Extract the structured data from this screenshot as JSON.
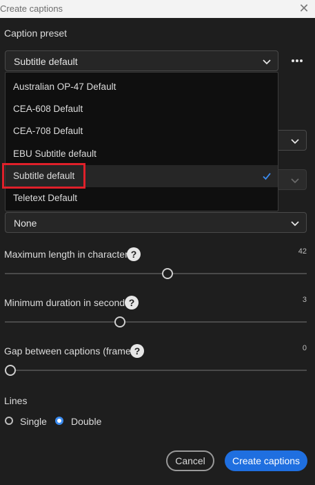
{
  "window": {
    "title": "Create captions",
    "close_icon": "close-icon"
  },
  "caption_preset": {
    "label": "Caption preset",
    "selected": "Subtitle default",
    "options": [
      "Australian OP-47 Default",
      "CEA-608 Default",
      "CEA-708 Default",
      "EBU Subtitle default",
      "Subtitle default",
      "Teletext Default"
    ],
    "selected_index": 4
  },
  "format_select": {
    "value": "None"
  },
  "max_length": {
    "label": "Maximum length in characters",
    "value": "42",
    "level": 0.55
  },
  "min_duration": {
    "label": "Minimum duration in seconds",
    "value": "3",
    "level": 0.38
  },
  "gap_frames": {
    "label": "Gap between captions (frames)",
    "value": "0",
    "level": 0.0
  },
  "lines": {
    "label": "Lines",
    "options": [
      {
        "label": "Single",
        "selected": false
      },
      {
        "label": "Double",
        "selected": true
      }
    ]
  },
  "buttons": {
    "cancel": "Cancel",
    "create": "Create captions"
  },
  "colors": {
    "accent": "#1f6fe0",
    "highlight": "#e0202a",
    "background": "#1e1e1e"
  }
}
